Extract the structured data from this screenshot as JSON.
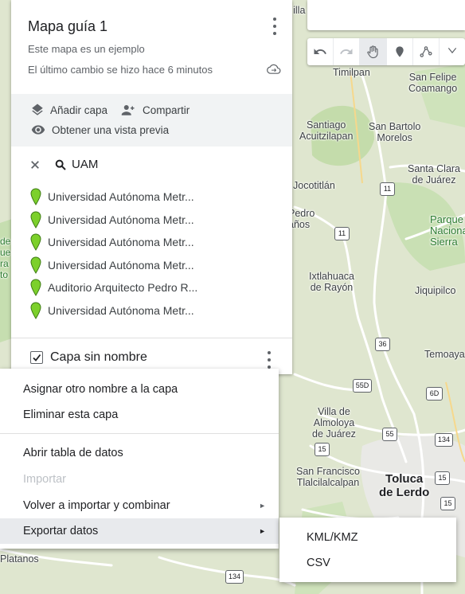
{
  "map": {
    "labels": [
      "Villa del Carbón",
      "Timilpan",
      "San Felipe\nCoamango",
      "Santiago\nAcuitzilapan",
      "San Bartolo\nMorelos",
      "Santa Clara\nde Juárez",
      "Jocotitlán",
      "Pedro\naños",
      "Ixtlahuaca\nde Rayón",
      "Jiquipilco",
      "Temoaya",
      "Villa de\nAlmoloya\nde Juárez",
      "San Francisco\nTlalcilalcalpan",
      "Toluca\nde Lerdo",
      "Platanos",
      "Parque\nNacional\nSierra",
      "de\nue\nra\nto"
    ],
    "routes": [
      "11",
      "11",
      "36",
      "55D",
      "55",
      "6D",
      "134",
      "15",
      "15",
      "15",
      "134"
    ]
  },
  "panel": {
    "title": "Mapa guía 1",
    "subtitle": "Este mapa es un ejemplo",
    "last_change": "El último cambio se hizo hace 6 minutos",
    "actions": {
      "add_layer": "Añadir capa",
      "share": "Compartir",
      "preview": "Obtener una vista previa"
    },
    "search": {
      "query": "UAM"
    },
    "results": [
      "Universidad Autónoma Metr...",
      "Universidad Autónoma Metr...",
      "Universidad Autónoma Metr...",
      "Universidad Autónoma Metr...",
      "Auditorio Arquitecto Pedro R...",
      "Universidad Autónoma Metr..."
    ],
    "layer": {
      "name": "Capa sin nombre",
      "checked": true
    }
  },
  "menu": {
    "rename": "Asignar otro nombre a la capa",
    "delete": "Eliminar esta capa",
    "open_table": "Abrir tabla de datos",
    "import": "Importar",
    "reimport": "Volver a importar y combinar",
    "export": "Exportar datos"
  },
  "submenu": {
    "kml": "KML/KMZ",
    "csv": "CSV"
  },
  "colors": {
    "pin": "#7cd02b",
    "map_bg": "#dfe6cf",
    "road": "#ffffff",
    "urban": "#e8e8e8",
    "hover": "#e8eaed"
  },
  "icons": [
    "more-vert-icon",
    "cloud-sync-icon",
    "layers-icon",
    "person-add-icon",
    "eye-icon",
    "close-icon",
    "search-icon",
    "map-pin-icon",
    "undo-icon",
    "redo-icon",
    "hand-icon",
    "marker-icon",
    "draw-line-icon"
  ]
}
